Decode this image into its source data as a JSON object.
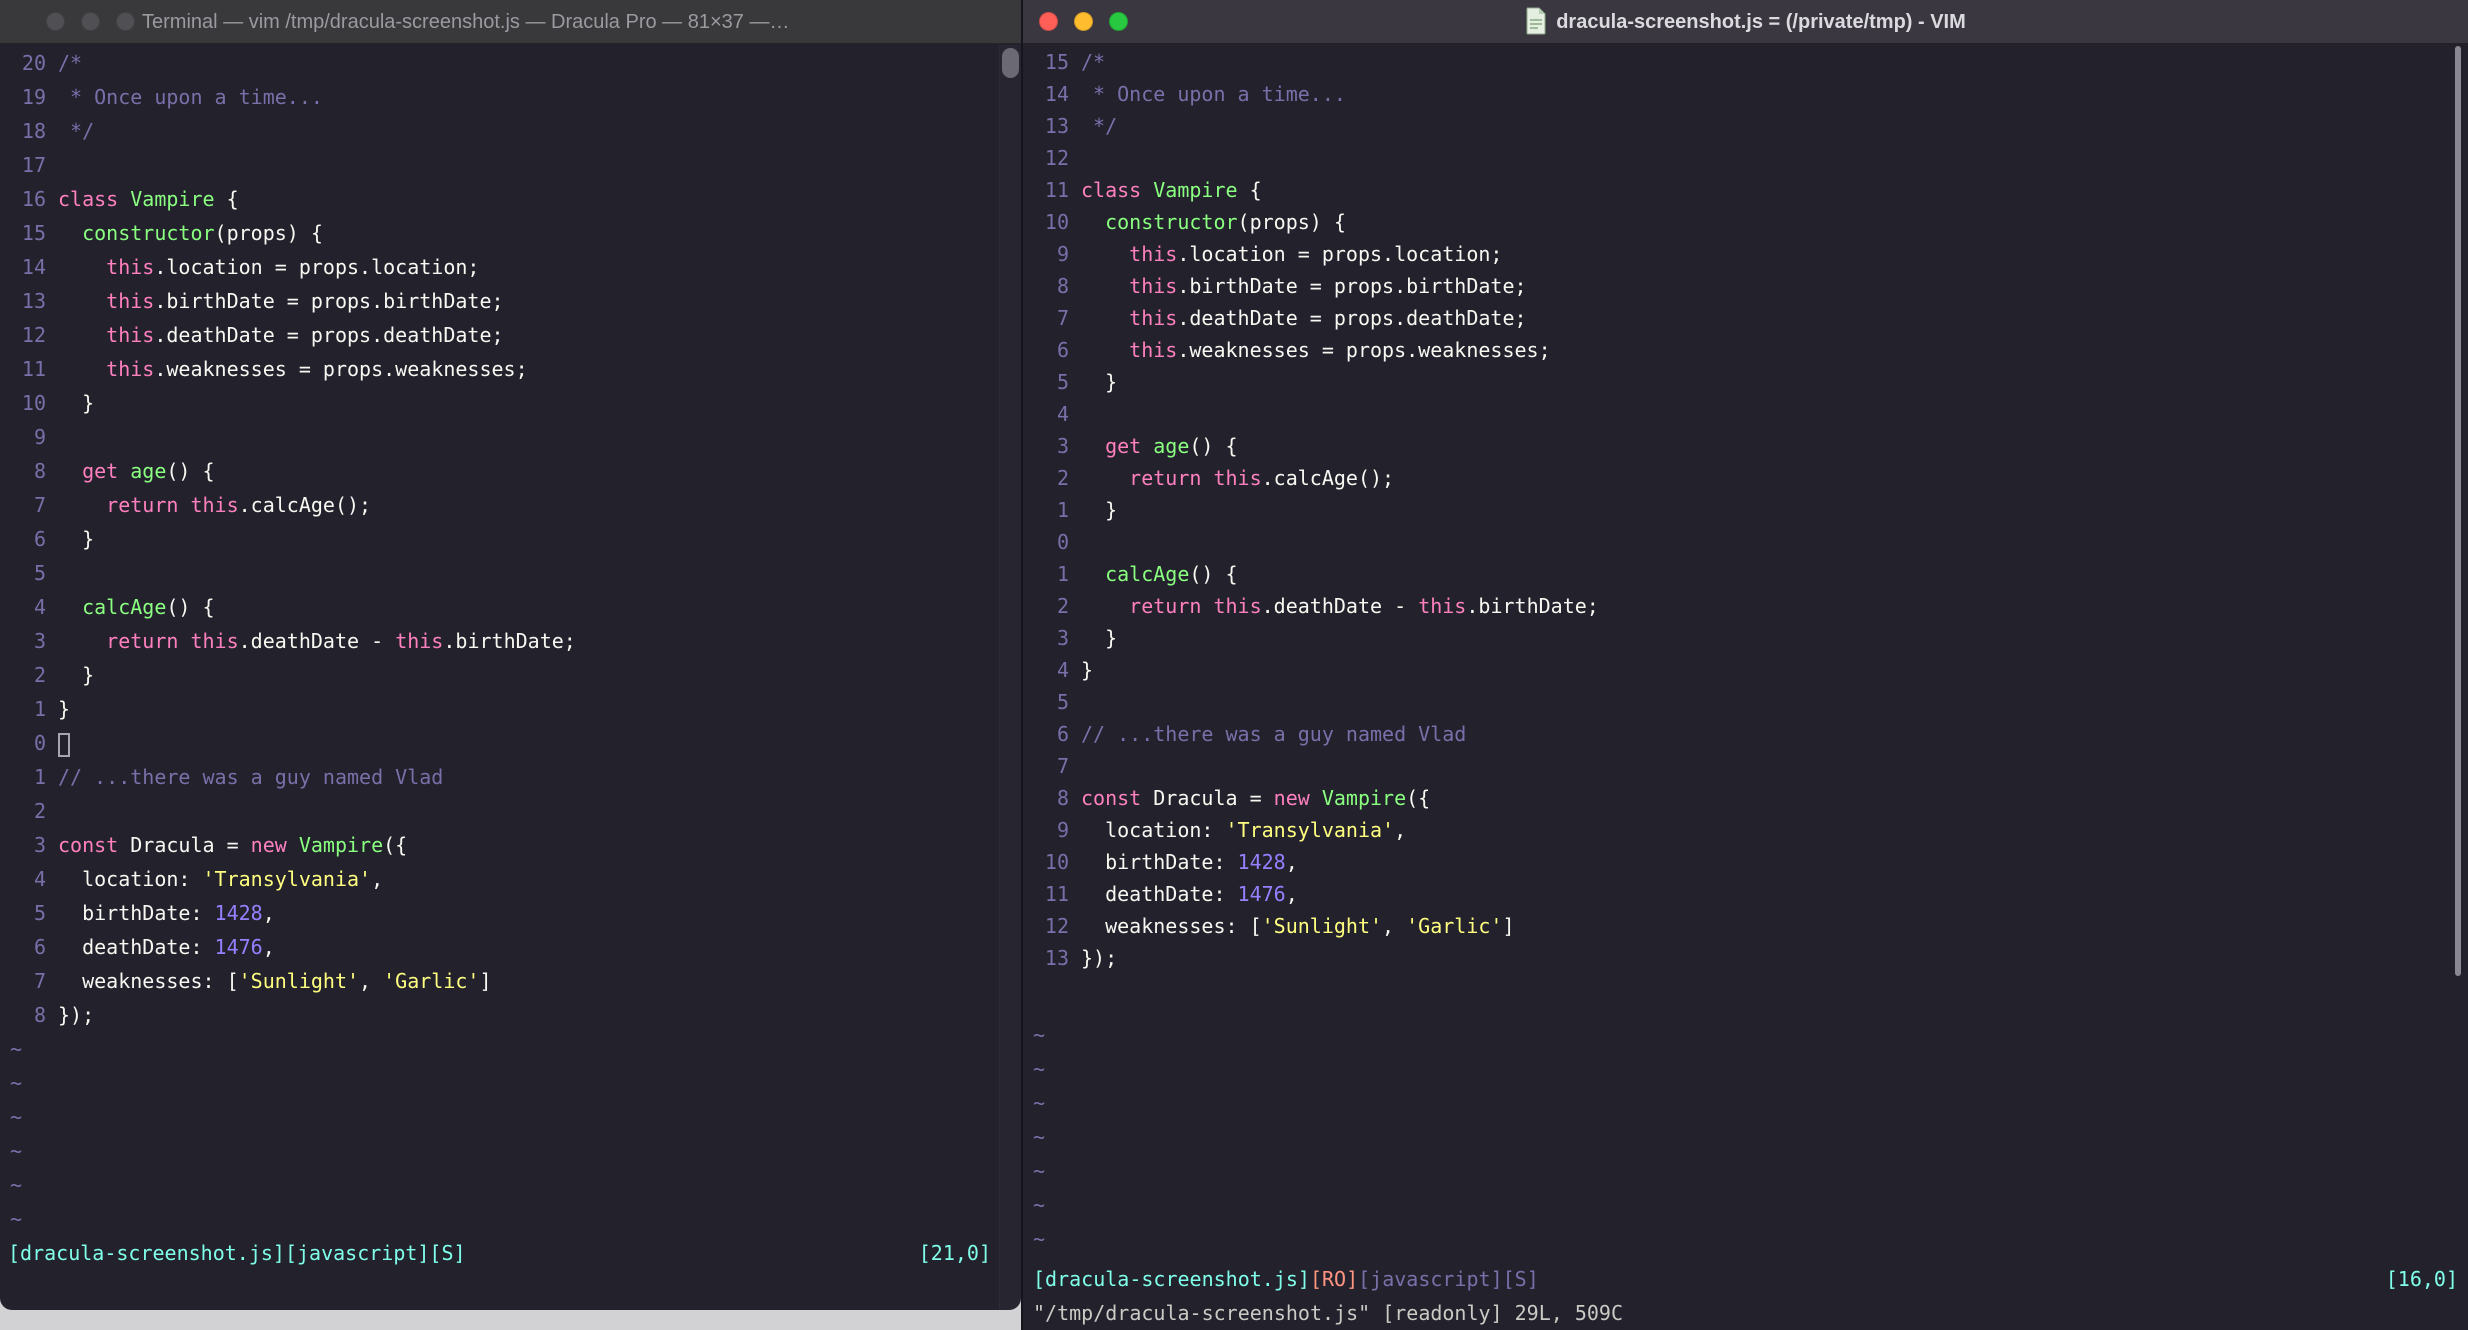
{
  "palette": {
    "background": "#22212C",
    "foreground": "#F8F8F2",
    "comment": "#7970A9",
    "pink": "#FF80BF",
    "green": "#8AFF80",
    "cyan": "#80FFEA",
    "purple": "#9580FF",
    "yellow": "#FFFF80",
    "orange": "#FF9580"
  },
  "empty_line_marker": "~",
  "code_lines": [
    [
      [
        "cm",
        "/*"
      ]
    ],
    [
      [
        "cm",
        " * Once upon a time..."
      ]
    ],
    [
      [
        "cm",
        " */"
      ]
    ],
    [],
    [
      [
        "kw",
        "class"
      ],
      [
        "fg",
        " "
      ],
      [
        "fn",
        "Vampire"
      ],
      [
        "fg",
        " {"
      ]
    ],
    [
      [
        "fg",
        "  "
      ],
      [
        "fn",
        "constructor"
      ],
      [
        "fg",
        "(props) {"
      ]
    ],
    [
      [
        "fg",
        "    "
      ],
      [
        "kw",
        "this"
      ],
      [
        "fg",
        ".location = props.location;"
      ]
    ],
    [
      [
        "fg",
        "    "
      ],
      [
        "kw",
        "this"
      ],
      [
        "fg",
        ".birthDate = props.birthDate;"
      ]
    ],
    [
      [
        "fg",
        "    "
      ],
      [
        "kw",
        "this"
      ],
      [
        "fg",
        ".deathDate = props.deathDate;"
      ]
    ],
    [
      [
        "fg",
        "    "
      ],
      [
        "kw",
        "this"
      ],
      [
        "fg",
        ".weaknesses = props.weaknesses;"
      ]
    ],
    [
      [
        "fg",
        "  }"
      ]
    ],
    [],
    [
      [
        "fg",
        "  "
      ],
      [
        "kw",
        "get"
      ],
      [
        "fg",
        " "
      ],
      [
        "fn",
        "age"
      ],
      [
        "fg",
        "() {"
      ]
    ],
    [
      [
        "fg",
        "    "
      ],
      [
        "kw",
        "return"
      ],
      [
        "fg",
        " "
      ],
      [
        "kw",
        "this"
      ],
      [
        "fg",
        ".calcAge();"
      ]
    ],
    [
      [
        "fg",
        "  }"
      ]
    ],
    [],
    [
      [
        "fg",
        "  "
      ],
      [
        "fn",
        "calcAge"
      ],
      [
        "fg",
        "() {"
      ]
    ],
    [
      [
        "fg",
        "    "
      ],
      [
        "kw",
        "return"
      ],
      [
        "fg",
        " "
      ],
      [
        "kw",
        "this"
      ],
      [
        "fg",
        ".deathDate - "
      ],
      [
        "kw",
        "this"
      ],
      [
        "fg",
        ".birthDate;"
      ]
    ],
    [
      [
        "fg",
        "  }"
      ]
    ],
    [
      [
        "fg",
        "}"
      ]
    ],
    [],
    [
      [
        "cm",
        "// ...there was a guy named Vlad"
      ]
    ],
    [],
    [
      [
        "kw",
        "const"
      ],
      [
        "fg",
        " Dracula = "
      ],
      [
        "kw",
        "new"
      ],
      [
        "fg",
        " "
      ],
      [
        "fn",
        "Vampire"
      ],
      [
        "fg",
        "({"
      ]
    ],
    [
      [
        "fg",
        "  location: "
      ],
      [
        "str",
        "'Transylvania'"
      ],
      [
        "fg",
        ","
      ]
    ],
    [
      [
        "fg",
        "  birthDate: "
      ],
      [
        "num",
        "1428"
      ],
      [
        "fg",
        ","
      ]
    ],
    [
      [
        "fg",
        "  deathDate: "
      ],
      [
        "num",
        "1476"
      ],
      [
        "fg",
        ","
      ]
    ],
    [
      [
        "fg",
        "  weaknesses: ["
      ],
      [
        "str",
        "'Sunlight'"
      ],
      [
        "fg",
        ", "
      ],
      [
        "str",
        "'Garlic'"
      ],
      [
        "fg",
        "]"
      ]
    ],
    [
      [
        "fg",
        "});"
      ]
    ]
  ],
  "windows": {
    "left": {
      "title": "Terminal — vim /tmp/dracula-screenshot.js — Dracula Pro — 81×37 —…",
      "line_numbers": [
        "20",
        "19",
        "18",
        "17",
        "16",
        "15",
        "14",
        "13",
        "12",
        "11",
        "10",
        "9",
        "8",
        "7",
        "6",
        "5",
        "4",
        "3",
        "2",
        "1",
        "0",
        "1",
        "2",
        "3",
        "4",
        "5",
        "6",
        "7",
        "8"
      ],
      "cursor_row": 20,
      "cursor_style": "hollow",
      "tilde_count": 6,
      "status_segments": [
        {
          "text": "[dracula-screenshot.js][javascript][S]",
          "color": "cyan"
        }
      ],
      "ruler": "[21,0]",
      "command_line": ""
    },
    "right": {
      "title": "dracula-screenshot.js = (/private/tmp) - VIM",
      "line_numbers": [
        "15",
        "14",
        "13",
        "12",
        "11",
        "10",
        "9",
        "8",
        "7",
        "6",
        "5",
        "4",
        "3",
        "2",
        "1",
        "0",
        "1",
        "2",
        "3",
        "4",
        "5",
        "6",
        "7",
        "8",
        "9",
        "10",
        "11",
        "12",
        "13"
      ],
      "cursor_row": 15,
      "cursor_style": "none",
      "tilde_count": 7,
      "status_segments": [
        {
          "text": "[dracula-screenshot.js]",
          "color": "cyan"
        },
        {
          "text": "[RO]",
          "color": "orange"
        },
        {
          "text": "[javascript][S]",
          "color": "dim"
        }
      ],
      "ruler": "[16,0]",
      "command_line": "\"/tmp/dracula-screenshot.js\" [readonly] 29L, 509C"
    }
  }
}
